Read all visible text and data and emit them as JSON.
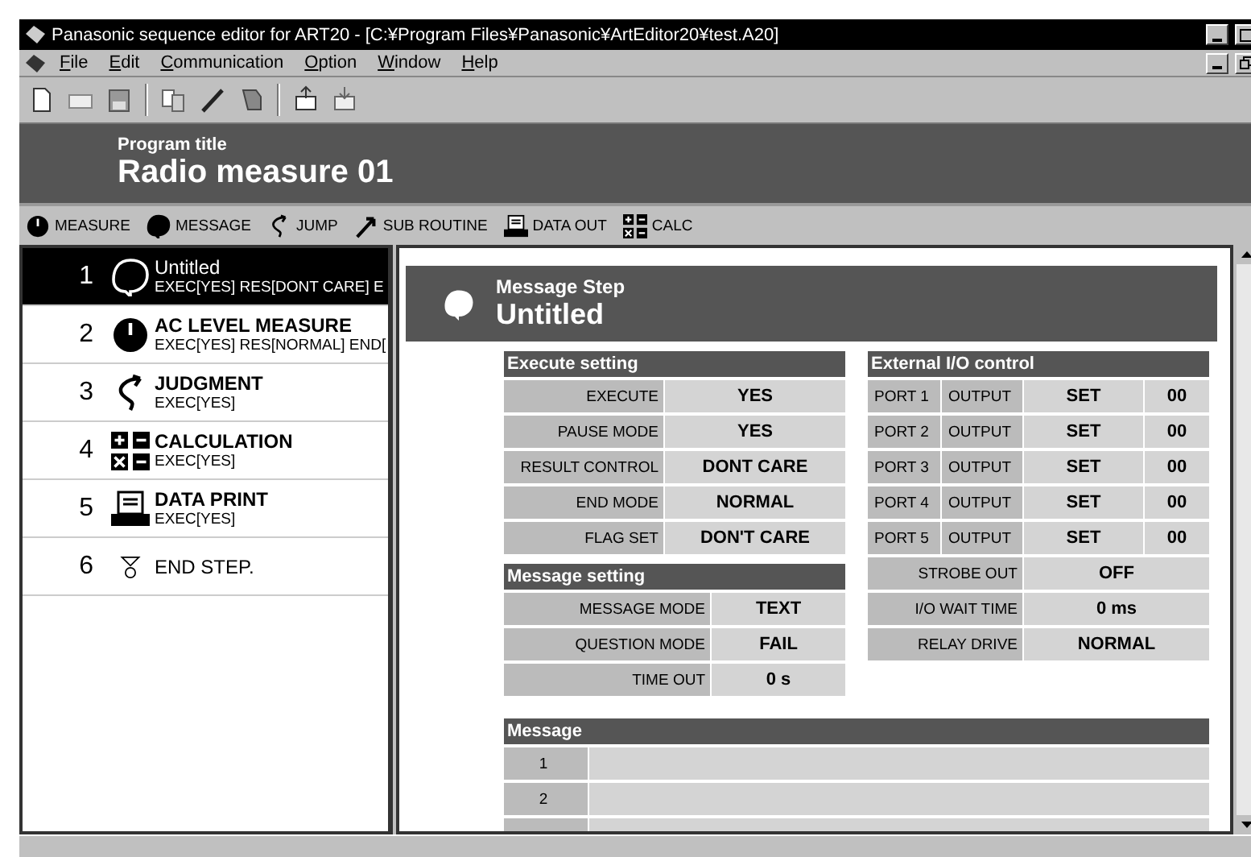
{
  "window": {
    "title": "Panasonic sequence editor for ART20 - [C:¥Program Files¥Panasonic¥ArtEditor20¥test.A20]"
  },
  "menu": [
    "File",
    "Edit",
    "Communication",
    "Option",
    "Window",
    "Help"
  ],
  "program": {
    "label": "Program title",
    "title": "Radio measure 01"
  },
  "step_toolbar": [
    {
      "kind": "measure",
      "label": "MEASURE"
    },
    {
      "kind": "message",
      "label": "MESSAGE"
    },
    {
      "kind": "jump",
      "label": "JUMP"
    },
    {
      "kind": "subroutine",
      "label": "SUB ROUTINE"
    },
    {
      "kind": "dataout",
      "label": "DATA OUT"
    },
    {
      "kind": "calc",
      "label": "CALC"
    }
  ],
  "steps": [
    {
      "number": "1",
      "kind": "message",
      "name": "Untitled",
      "detail": "EXEC[YES] RES[DONT CARE] E",
      "selected": true
    },
    {
      "number": "2",
      "kind": "measure",
      "name": "AC LEVEL MEASURE",
      "detail": "EXEC[YES] RES[NORMAL] END[",
      "selected": false
    },
    {
      "number": "3",
      "kind": "jump",
      "name": "JUDGMENT",
      "detail": "EXEC[YES]",
      "selected": false
    },
    {
      "number": "4",
      "kind": "calc",
      "name": "CALCULATION",
      "detail": "EXEC[YES]",
      "selected": false
    },
    {
      "number": "5",
      "kind": "dataout",
      "name": "DATA PRINT",
      "detail": "EXEC[YES]",
      "selected": false
    },
    {
      "number": "6",
      "kind": "end",
      "name": "END STEP.",
      "selected": false
    }
  ],
  "step_header": {
    "label": "Message Step",
    "title": "Untitled"
  },
  "execute_setting": {
    "title": "Execute setting",
    "rows": [
      {
        "label": "EXECUTE",
        "value": "YES"
      },
      {
        "label": "PAUSE MODE",
        "value": "YES"
      },
      {
        "label": "RESULT CONTROL",
        "value": "DONT CARE"
      },
      {
        "label": "END MODE",
        "value": "NORMAL"
      },
      {
        "label": "FLAG SET",
        "value": "DON'T CARE"
      }
    ]
  },
  "message_setting": {
    "title": "Message setting",
    "rows": [
      {
        "label": "MESSAGE MODE",
        "value": "TEXT"
      },
      {
        "label": "QUESTION MODE",
        "value": "FAIL"
      },
      {
        "label": "TIME OUT",
        "value": "0 s"
      }
    ]
  },
  "external_io": {
    "title": "External I/O control",
    "ports": [
      {
        "port": "PORT 1",
        "mode": "OUTPUT",
        "action": "SET",
        "code": "00"
      },
      {
        "port": "PORT 2",
        "mode": "OUTPUT",
        "action": "SET",
        "code": "00"
      },
      {
        "port": "PORT 3",
        "mode": "OUTPUT",
        "action": "SET",
        "code": "00"
      },
      {
        "port": "PORT 4",
        "mode": "OUTPUT",
        "action": "SET",
        "code": "00"
      },
      {
        "port": "PORT 5",
        "mode": "OUTPUT",
        "action": "SET",
        "code": "00"
      }
    ],
    "rows": [
      {
        "label": "STROBE OUT",
        "value": "OFF"
      },
      {
        "label": "I/O WAIT TIME",
        "value": "0 ms"
      },
      {
        "label": "RELAY DRIVE",
        "value": "NORMAL"
      }
    ]
  },
  "message": {
    "title": "Message",
    "rows": [
      "1",
      "2"
    ]
  }
}
